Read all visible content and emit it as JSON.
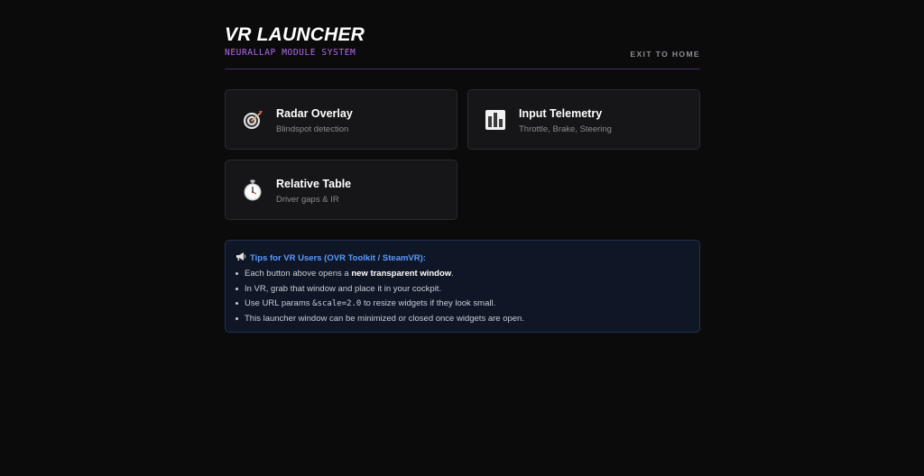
{
  "header": {
    "title": "VR LAUNCHER",
    "subtitle": "NEURALLAP MODULE SYSTEM",
    "exit_label": "EXIT TO HOME"
  },
  "cards": [
    {
      "icon": "dart-target-icon",
      "title": "Radar Overlay",
      "desc": "Blindspot detection"
    },
    {
      "icon": "bar-chart-icon",
      "title": "Input Telemetry",
      "desc": "Throttle, Brake, Steering"
    },
    {
      "icon": "stopwatch-icon",
      "title": "Relative Table",
      "desc": "Driver gaps & IR"
    }
  ],
  "tips": {
    "icon": "megaphone-icon",
    "heading": "Tips for VR Users (OVR Toolkit / SteamVR):",
    "items": [
      {
        "pre": "Each button above opens a ",
        "bold": "new transparent window",
        "post": "."
      },
      {
        "text": "In VR, grab that window and place it in your cockpit."
      },
      {
        "pre": "Use URL params ",
        "code": "&scale=2.0",
        "post": " to resize widgets if they look small."
      },
      {
        "text": "This launcher window can be minimized or closed once widgets are open."
      }
    ]
  },
  "colors": {
    "background": "#0b0b0c",
    "accent_purple": "#b36cf0",
    "tips_heading_blue": "#5b9bff",
    "card_bg": "#161618"
  }
}
